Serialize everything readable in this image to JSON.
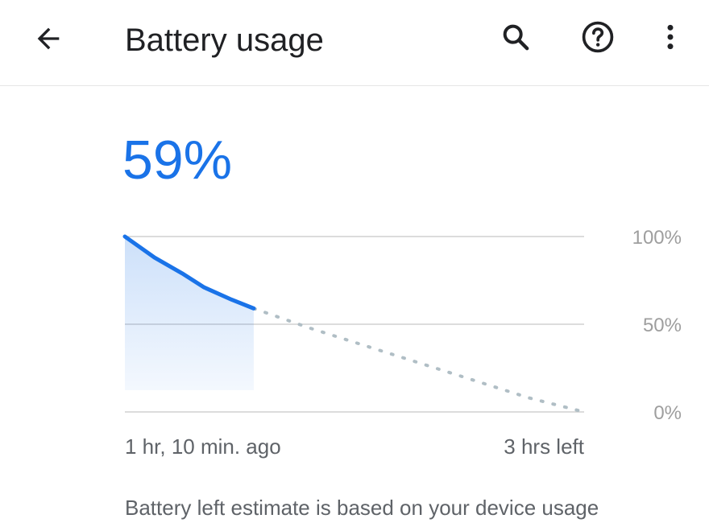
{
  "app_bar": {
    "title": "Battery usage",
    "back_icon": "arrow-back-icon",
    "search_icon": "search-icon",
    "help_icon": "help-icon",
    "more_icon": "more-vert-icon"
  },
  "battery": {
    "level_text": "59%"
  },
  "chart_data": {
    "type": "line",
    "title": "",
    "ylabel": "",
    "xlabel": "",
    "ylim": [
      0,
      100
    ],
    "y_tick_labels": [
      "100%",
      "50%",
      "0%"
    ],
    "x_labels": {
      "start": "1 hr, 10 min. ago",
      "end": "3 hrs left"
    },
    "series": [
      {
        "style": "solid",
        "color": "#1a73e8",
        "fill": true,
        "x_hours": [
          -1.17,
          -0.9,
          -0.65,
          -0.45,
          -0.2,
          0
        ],
        "y": [
          100,
          88,
          79,
          71,
          64,
          59
        ]
      },
      {
        "style": "dotted",
        "color": "#b0bec5",
        "x_hours": [
          0,
          0.5,
          1.0,
          1.5,
          2.0,
          2.5,
          3.0
        ],
        "y": [
          59,
          48,
          38,
          28,
          18,
          8,
          0
        ]
      }
    ],
    "grid": true
  },
  "footer": {
    "summary": "Battery left estimate is based on your device usage"
  },
  "colors": {
    "accent": "#1a73e8",
    "grid": "#d0d0d0",
    "projection": "#b0bec5"
  }
}
